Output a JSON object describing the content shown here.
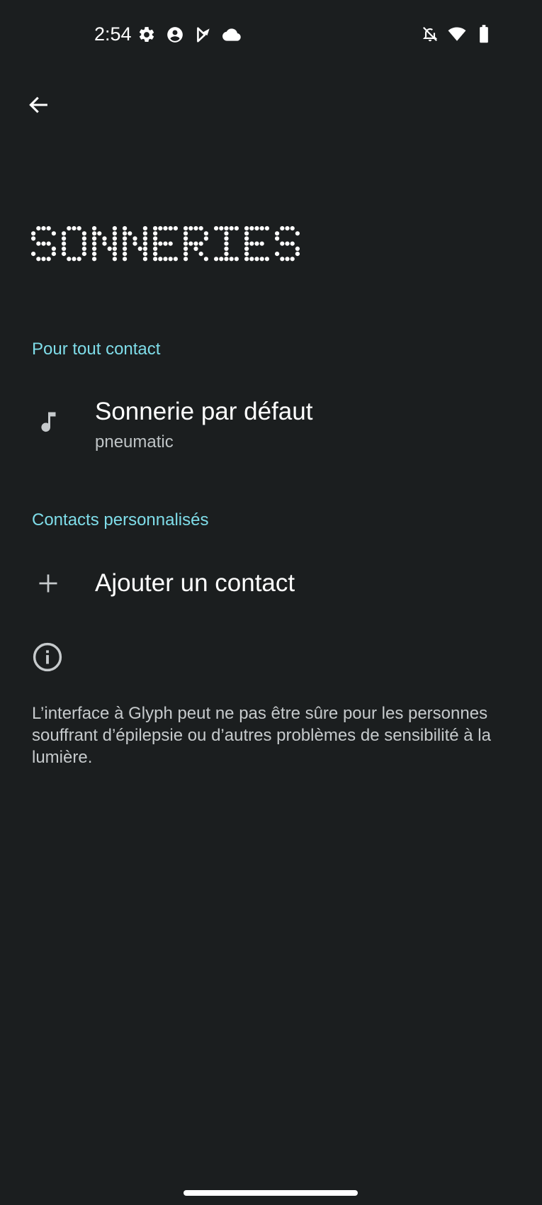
{
  "status_bar": {
    "time": "2:54",
    "left_icons": [
      "gear-icon",
      "account-circle-icon",
      "play-store-icon",
      "cloud-icon"
    ],
    "right_icons": [
      "notifications-off-icon",
      "wifi-icon",
      "battery-icon"
    ]
  },
  "header": {
    "back_icon": "arrow-left-icon",
    "title": "SONNERIES"
  },
  "sections": [
    {
      "header": "Pour tout contact",
      "items": [
        {
          "icon": "music-note-icon",
          "title": "Sonnerie par défaut",
          "summary": "pneumatic"
        }
      ]
    },
    {
      "header": "Contacts personnalisés",
      "items": [
        {
          "icon": "plus-icon",
          "title": "Ajouter un contact"
        }
      ]
    }
  ],
  "footer": {
    "icon": "info-icon",
    "text": "L’interface à Glyph peut ne pas être sûre pour les personnes souffrant d’épilepsie ou d’autres problèmes de sensibilité à la lumière."
  },
  "colors": {
    "background": "#1b1e1f",
    "accent": "#7fdde9",
    "primary_text": "#ffffff",
    "secondary_text": "#bfc4c6"
  }
}
